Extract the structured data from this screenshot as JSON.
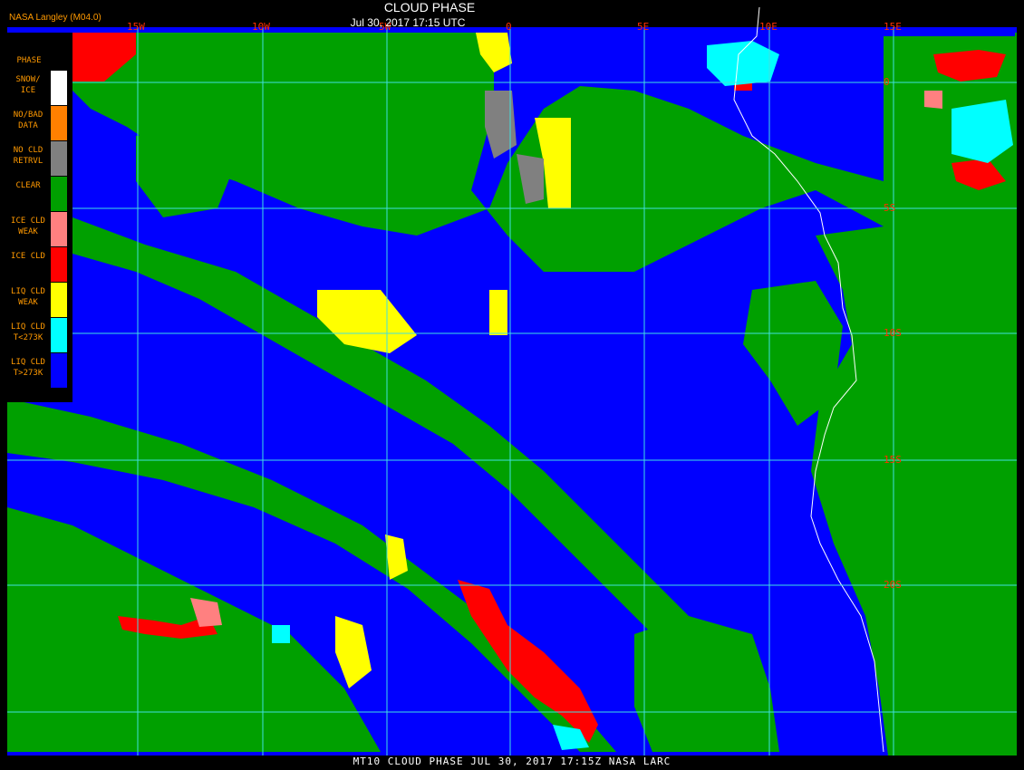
{
  "header": {
    "credit": "NASA Langley (M04.0)",
    "title": "CLOUD PHASE",
    "date": "Jul 30, 2017 17:15 UTC"
  },
  "footer": "MT10  CLOUD PHASE   JUL 30, 2017 17:15Z   NASA LARC",
  "legend": {
    "title": "PHASE",
    "items": [
      {
        "label": "SNOW/\nICE",
        "color": "#ffffff"
      },
      {
        "label": "NO/BAD\nDATA",
        "color": "#ff8000"
      },
      {
        "label": "NO CLD\nRETRVL",
        "color": "#808080"
      },
      {
        "label": "CLEAR",
        "color": "#00a000"
      },
      {
        "label": "ICE CLD\nWEAK",
        "color": "#ff8080"
      },
      {
        "label": "ICE CLD",
        "color": "#ff0000"
      },
      {
        "label": "LIQ CLD\nWEAK",
        "color": "#ffff00"
      },
      {
        "label": "LIQ CLD\nT<273K",
        "color": "#00ffff"
      },
      {
        "label": "LIQ CLD\nT>273K",
        "color": "#0000ff"
      }
    ]
  },
  "grid": {
    "lon_labels": [
      "15W",
      "10W",
      "5W",
      "0",
      "5E",
      "10E",
      "15E"
    ],
    "lat_labels": [
      "0",
      "5S",
      "10S",
      "15S",
      "20S"
    ],
    "line_color": "#40e0e0",
    "label_color": "#ff3000"
  }
}
